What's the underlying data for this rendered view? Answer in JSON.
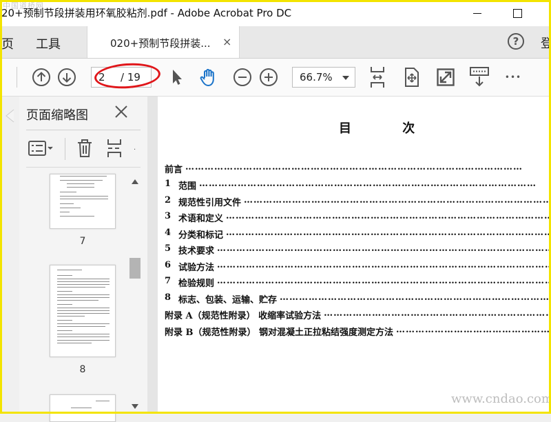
{
  "window": {
    "title": "20+预制节段拼装用环氧胶粘剂.pdf - Adobe Acrobat Pro DC",
    "watermark_top": "中国道桥网"
  },
  "menubar": {
    "page_partial": "页",
    "tools": "工具",
    "tab_label": "020+预制节段拼装...",
    "tab_close": "×",
    "help": "?",
    "login_partial": "登"
  },
  "toolbar": {
    "page_current": "2",
    "page_total": "/ 19",
    "zoom": "66.7%",
    "more": "•••"
  },
  "thumb_panel": {
    "title": "页面缩略图",
    "pages": [
      {
        "number": "7"
      },
      {
        "number": "8"
      }
    ]
  },
  "document": {
    "title": "目 次",
    "toc": [
      {
        "num": "",
        "text": "前言"
      },
      {
        "num": "1",
        "text": "范围"
      },
      {
        "num": "2",
        "text": "规范性引用文件"
      },
      {
        "num": "3",
        "text": "术语和定义"
      },
      {
        "num": "4",
        "text": "分类和标记"
      },
      {
        "num": "5",
        "text": "技术要求"
      },
      {
        "num": "6",
        "text": "试验方法"
      },
      {
        "num": "7",
        "text": "检验规则"
      },
      {
        "num": "8",
        "text": "标志、包装、运输、贮存"
      },
      {
        "num": "",
        "text": "附录 A（规范性附录）  收缩率试验方法"
      },
      {
        "num": "",
        "text": "附录 B（规范性附录）  钢对混凝土正拉粘结强度测定方法"
      }
    ],
    "watermark": "www.cndao.com"
  },
  "colors": {
    "frame": "#f3e400",
    "annotation": "#e0161a",
    "hand_tool": "#1a73c9"
  }
}
